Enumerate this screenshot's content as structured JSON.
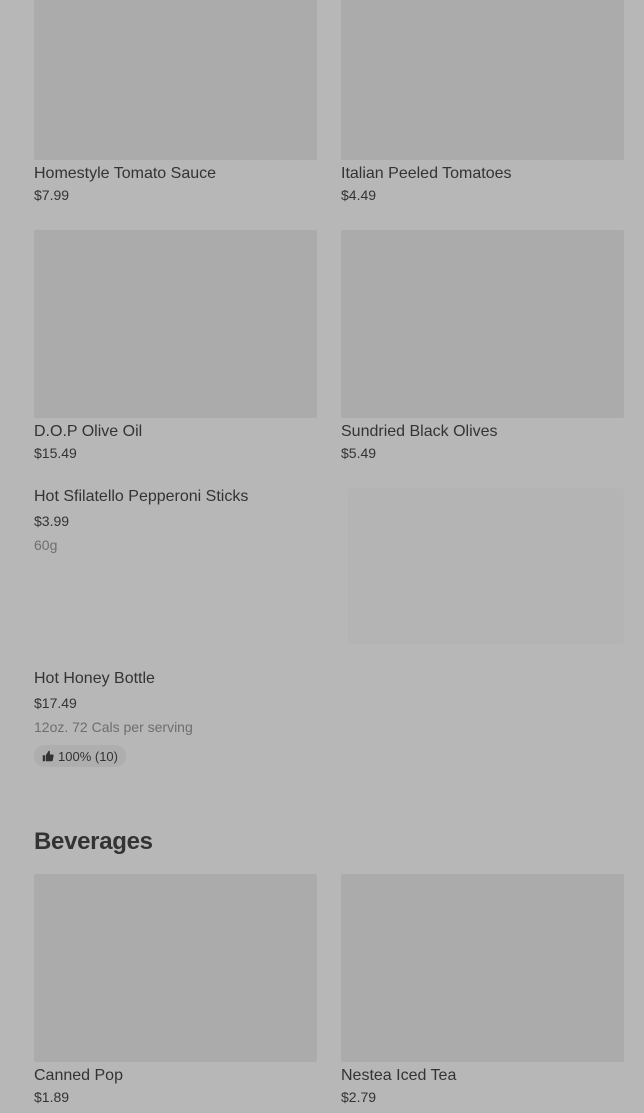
{
  "grid1": {
    "items": [
      {
        "name": "Homestyle Tomato Sauce",
        "price": "$7.99"
      },
      {
        "name": "Italian Peeled Tomatoes",
        "price": "$4.49"
      },
      {
        "name": "D.O.P Olive Oil",
        "price": "$15.49"
      },
      {
        "name": "Sundried Black Olives",
        "price": "$5.49"
      }
    ]
  },
  "list_items": [
    {
      "name": "Hot Sfilatello Pepperoni Sticks",
      "price": "$3.99",
      "meta": "60g"
    },
    {
      "name": "Hot Honey Bottle",
      "price": "$17.49",
      "meta": "12oz. 72 Cals per serving",
      "rating": "100% (10)"
    }
  ],
  "beverages": {
    "title": "Beverages",
    "items": [
      {
        "name": "Canned Pop",
        "price": "$1.89"
      },
      {
        "name": "Nestea Iced Tea",
        "price": "$2.79"
      }
    ]
  },
  "icons": {
    "rating": "thumbs-up-icon"
  },
  "colors": {
    "background": "#b7b7b7",
    "image_placeholder": "#ababab",
    "text": "#333333",
    "muted_text": "#6e6e6e"
  }
}
